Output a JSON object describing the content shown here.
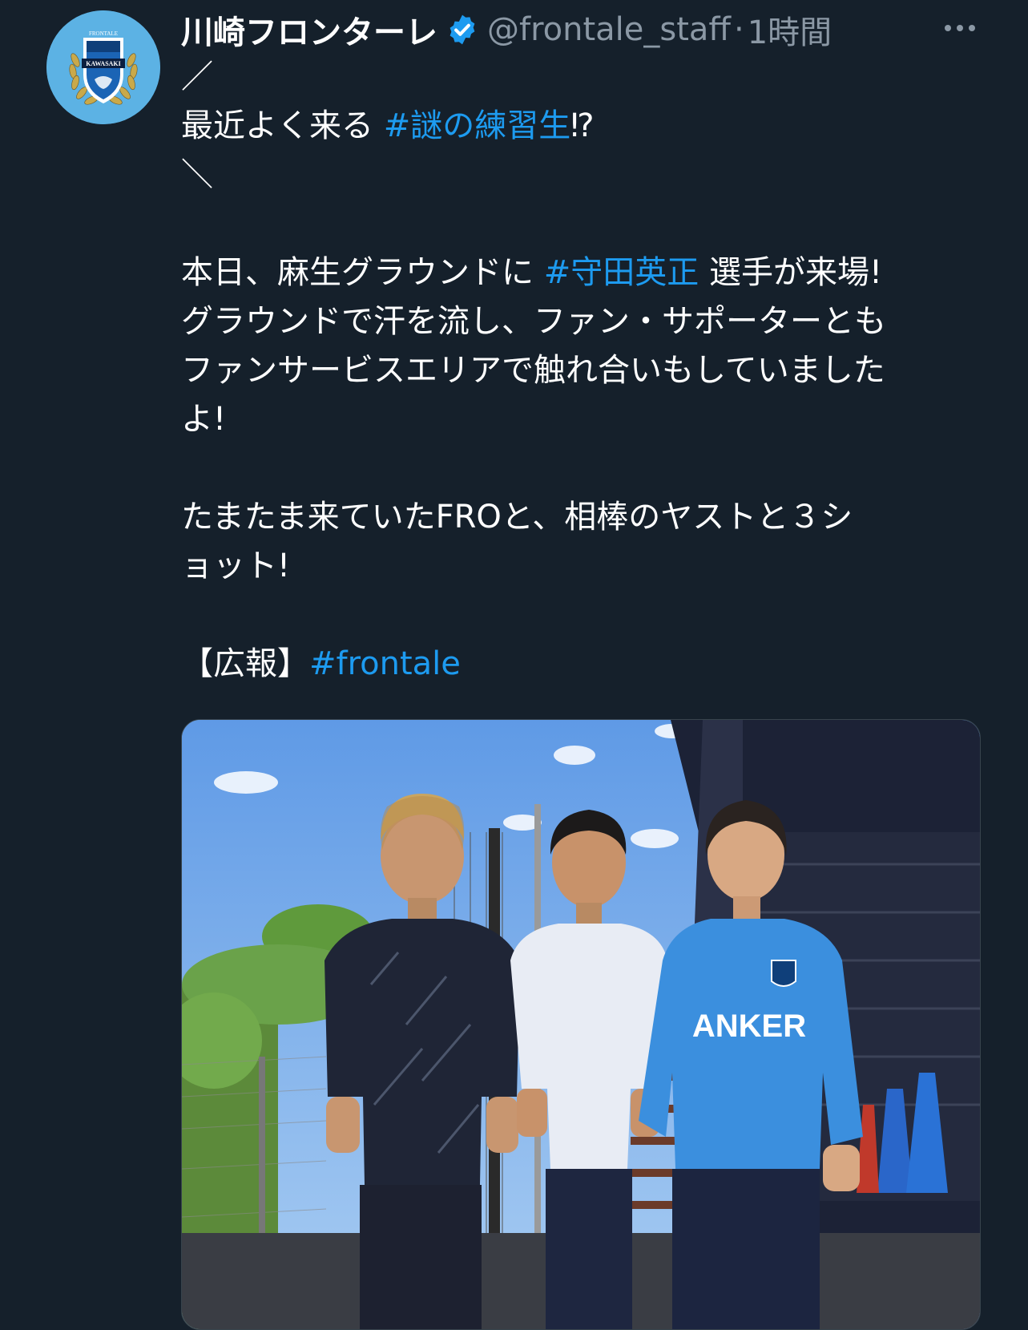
{
  "tweet": {
    "display_name": "川崎フロンターレ",
    "handle": "@frontale_staff",
    "separator": "·",
    "time": "1時間",
    "lines": [
      {
        "pre": "／",
        "tag": "",
        "post": ""
      },
      {
        "pre": "最近よく来る ",
        "tag": "#謎の練習生",
        "post": "⁉"
      },
      {
        "pre": "＼",
        "tag": "",
        "post": ""
      },
      {
        "gap": true
      },
      {
        "pre": "本日、麻生グラウンドに ",
        "tag": "#守田英正",
        "post": " 選手が来場!"
      },
      {
        "pre": "グラウンドで汗を流し、ファン・サポーターとも",
        "tag": "",
        "post": ""
      },
      {
        "pre": "ファンサービスエリアで触れ合いもしていました",
        "tag": "",
        "post": ""
      },
      {
        "pre": "よ!",
        "tag": "",
        "post": ""
      },
      {
        "gap": true
      },
      {
        "pre": "たまたま来ていたFROと、相棒のヤストと３シ",
        "tag": "",
        "post": ""
      },
      {
        "pre": "ョット!",
        "tag": "",
        "post": ""
      },
      {
        "gap": true
      },
      {
        "pre": "【広報】",
        "tag": "#frontale",
        "post": ""
      }
    ]
  },
  "avatar": {
    "arc_text": "FRONTALE",
    "band_text": "KAWASAKI",
    "color": "#5cb2e4"
  },
  "photo": {
    "shirt_text": "ANKER"
  },
  "colors": {
    "background": "#15202b",
    "text": "#ffffff",
    "muted": "#8b98a5",
    "link": "#1d9bf0",
    "verified": "#1d9bf0"
  }
}
